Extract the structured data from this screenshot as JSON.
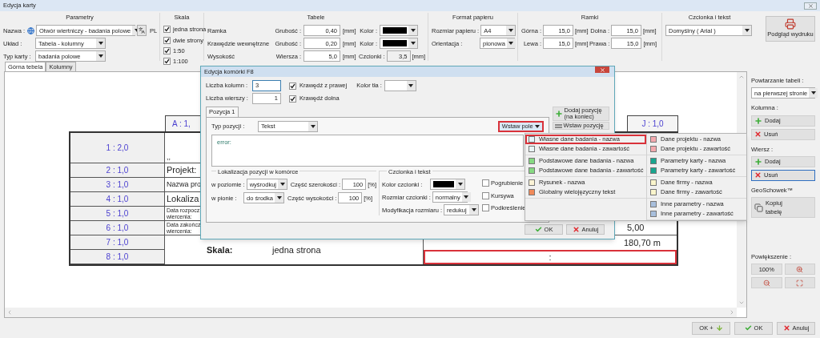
{
  "window": {
    "title": "Edycja karty"
  },
  "toolbar": {
    "parametry": {
      "title": "Parametry",
      "name_label": "Nazwa :",
      "name_value": "Otwór wiertniczy - badania polowe",
      "language": "PL",
      "layout_label": "Układ :",
      "layout_value": "Tabela - kolumny",
      "type_label": "Typ karty :",
      "type_value": "badania polowe"
    },
    "skala": {
      "title": "Skala",
      "options": [
        {
          "label": "jedna strona",
          "checked": true
        },
        {
          "label": "dwie strony",
          "checked": true
        },
        {
          "label": "1:50",
          "checked": true
        },
        {
          "label": "1:100",
          "checked": true
        }
      ]
    },
    "tabele": {
      "title": "Tabele",
      "rows": [
        {
          "label": "Ramka",
          "field_label": "Grubość :",
          "value": "0,40",
          "unit": "[mm]",
          "color_label": "Kolor :",
          "color": "#000000"
        },
        {
          "label": "Krawędzie wewnętrzne",
          "field_label": "Grubość :",
          "value": "0,20",
          "unit": "[mm]",
          "color_label": "Kolor :",
          "color": "#000000"
        },
        {
          "label": "Wysokość",
          "field_label": "Wiersza :",
          "value": "5,0",
          "unit": "[mm]",
          "extra_label": "Czcionki :",
          "extra_value": "3,5",
          "extra_unit": "[mm]"
        }
      ]
    },
    "format": {
      "title": "Format papieru",
      "fields": [
        {
          "label": "Rozmiar papieru :",
          "value": "A4"
        },
        {
          "label": "Orientacja :",
          "value": "pionowa"
        }
      ]
    },
    "ramki": {
      "title": "Ramki",
      "rows": [
        [
          {
            "label": "Górna :",
            "value": "15,0",
            "unit": "[mm]"
          },
          {
            "label": "Dolna :",
            "value": "15,0",
            "unit": "[mm]"
          }
        ],
        [
          {
            "label": "Lewa :",
            "value": "15,0",
            "unit": "[mm]"
          },
          {
            "label": "Prawa :",
            "value": "15,0",
            "unit": "[mm]"
          }
        ]
      ]
    },
    "czcionka": {
      "title": "Czcionka i tekst",
      "value": "Domyślny ( Arial )"
    },
    "preview_button": "Podgląd wydruku"
  },
  "tabs": [
    {
      "label": "Górna tebela",
      "selected": true
    },
    {
      "label": "Kolumny",
      "selected": false
    }
  ],
  "canvas": {
    "first_column": "A : 1,",
    "last_column": "J : 1,0",
    "rows": [
      {
        "label": "1 : 2,0",
        "kind": "plain",
        "lines": [
          ",,"
        ]
      },
      {
        "label": "2 : 1,0",
        "kind": "large",
        "lines": [
          "Projekt:"
        ]
      },
      {
        "label": "3 : 1,0",
        "kind": "medium",
        "lines": [
          "Nazwa pro"
        ]
      },
      {
        "label": "4 : 1,0",
        "kind": "large",
        "lines": [
          "Lokaliza"
        ]
      },
      {
        "label": "5 : 1,0",
        "kind": "small",
        "lines": [
          "Data rozpocz",
          "wiercenia:"
        ]
      },
      {
        "label": "6 : 1,0",
        "kind": "small",
        "lines": [
          "Data zakończ",
          "wiercenia:"
        ],
        "value": "5,00"
      },
      {
        "label": "7 : 1,0"
      },
      {
        "label": "8 : 1,0"
      }
    ],
    "merged": {
      "label": "Skala:",
      "value": "jedna strona"
    },
    "cells": [
      {
        "text": "180,70 m",
        "selected": false
      },
      {
        "text": ":",
        "selected": true
      }
    ]
  },
  "side_panel": {
    "repeat_label": "Powtarzanie tabeli :",
    "repeat_value": "na pierwszej stronie",
    "sections": [
      {
        "title": "Kolumna :",
        "buttons": [
          {
            "label": "Dodaj",
            "kind": "add",
            "focused": false
          },
          {
            "label": "Usuń",
            "kind": "delete",
            "focused": false
          }
        ]
      },
      {
        "title": "Wiersz :",
        "buttons": [
          {
            "label": "Dodaj",
            "kind": "add",
            "focused": false
          },
          {
            "label": "Usuń",
            "kind": "delete",
            "focused": true
          }
        ]
      }
    ],
    "clipboard_title": "GeoSchowek™",
    "copy_button": "Kopiuj tabelę",
    "zoom_label": "Powiększenie :",
    "zoom_value": "100%"
  },
  "footer": {
    "buttons": [
      {
        "label": "OK +",
        "kind": "next"
      },
      {
        "label": "OK",
        "kind": "ok"
      },
      {
        "label": "Anuluj",
        "kind": "cancel"
      }
    ]
  },
  "dialog": {
    "title": "Edycja komórki F8",
    "columns_label": "Liczba kolumn :",
    "columns_value": "3",
    "rows_label": "Liczba wierszy :",
    "rows_value": "1",
    "right_border": {
      "label": "Krawędź z prawej",
      "checked": true
    },
    "bottom_border": {
      "label": "Krawędź dolna",
      "checked": true
    },
    "background_label": "Kolor tła :",
    "tabs": [
      {
        "label": "Pozycja 1",
        "selected": true
      }
    ],
    "side_buttons": [
      {
        "label": "Dodaj pozycję (na koniec)",
        "kind": "add"
      },
      {
        "label": "Wstaw pozycję",
        "kind": "insert"
      }
    ],
    "type_label": "Typ pozycji :",
    "type_value": "Tekst",
    "insert_field_button": {
      "label": "Wstaw pole",
      "highlighted": true
    },
    "text": "error:",
    "location": {
      "title": "Lokalizacja pozycji w komórce",
      "rows": [
        {
          "label": "w poziomie :",
          "value": "wyśrodkuj",
          "part_label": "Część szerokości :",
          "part_value": "100",
          "unit": "[%]"
        },
        {
          "label": "w pionie :",
          "value": "do środka",
          "part_label": "Część wysokości :",
          "part_value": "100",
          "unit": "[%]"
        }
      ]
    },
    "font": {
      "title": "Czcionka i tekst",
      "fields": [
        {
          "label": "Kolor czcionki :",
          "kind": "color",
          "color": "#000000"
        },
        {
          "label": "Rozmiar czcionki :",
          "kind": "select",
          "value": "normalny"
        },
        {
          "label": "Modyfikacja rozmiaru :",
          "kind": "select",
          "value": "redukuj"
        }
      ],
      "styles": [
        {
          "label": "Pogrubienie",
          "checked": false
        },
        {
          "label": "Kursywa",
          "checked": false
        },
        {
          "label": "Podkreślenie",
          "checked": false
        }
      ]
    },
    "buttons": [
      {
        "label": "OK",
        "kind": "ok"
      },
      {
        "label": "Anuluj",
        "kind": "cancel"
      }
    ]
  },
  "menu": {
    "columns": [
      {
        "groups": [
          {
            "items": [
              {
                "label": "Własne dane badania - nazwa",
                "color": "#e3f4fb",
                "selected": true
              },
              {
                "label": "Własne dane badania - zawartość",
                "color": "#e9f5f5",
                "selected": false
              }
            ]
          },
          {
            "items": [
              {
                "label": "Podstawowe dane badania - nazwa",
                "color": "#86d982",
                "selected": false
              },
              {
                "label": "Podstawowe dane badania - zawartość",
                "color": "#86d982",
                "selected": false
              }
            ]
          },
          {
            "items": [
              {
                "label": "Rysunek - nazwa",
                "color": "#fbf3d6",
                "selected": false
              },
              {
                "label": "Globalny wielojęzyczny tekst",
                "color": "#f08a5a",
                "selected": false
              }
            ]
          }
        ]
      },
      {
        "groups": [
          {
            "items": [
              {
                "label": "Dane projektu - nazwa",
                "color": "#f3a9ae",
                "selected": false
              },
              {
                "label": "Dane projektu - zawartość",
                "color": "#f3a9ae",
                "selected": false
              }
            ]
          },
          {
            "items": [
              {
                "label": "Parametry karty - nazwa",
                "color": "#19a58f",
                "selected": false
              },
              {
                "label": "Parametry karty - zawartość",
                "color": "#19a58f",
                "selected": false
              }
            ]
          },
          {
            "items": [
              {
                "label": "Dane firmy - nazwa",
                "color": "#faf5cc",
                "selected": false
              },
              {
                "label": "Dane firmy - zawartość",
                "color": "#faf5cc",
                "selected": false
              }
            ]
          },
          {
            "items": [
              {
                "label": "Inne parametry - nazwa",
                "color": "#a8bfdc",
                "selected": false
              },
              {
                "label": "Inne parametry - zawartość",
                "color": "#a8bfdc",
                "selected": false
              }
            ]
          }
        ]
      }
    ]
  }
}
